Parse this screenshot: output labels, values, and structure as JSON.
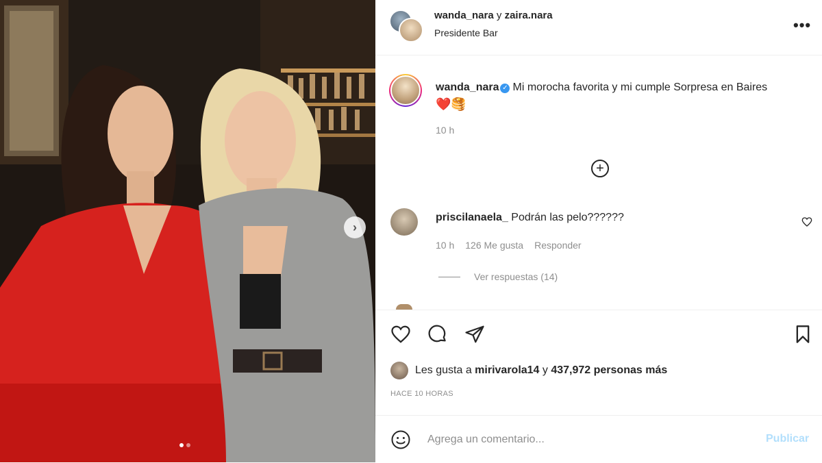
{
  "post": {
    "header": {
      "username_1": "wanda_nara",
      "connector": " y ",
      "username_2": "zaira.nara",
      "location": "Presidente Bar",
      "more_label": "•••"
    },
    "caption": {
      "username": "wanda_nara",
      "text": "Mi morocha favorita y mi cumple Sorpresa en Baires",
      "emojis": "❤️🥞",
      "time": "10 h"
    },
    "comments": [
      {
        "username": "priscilanaela_",
        "text": "Podrán las pelo??????",
        "time": "10 h",
        "likes": "126 Me gusta",
        "reply_label": "Responder",
        "view_replies": "Ver respuestas (14)"
      }
    ],
    "likes": {
      "prefix": "Les gusta a ",
      "user": "mirivarola14",
      "connector": " y ",
      "others": "437,972 personas más"
    },
    "timestamp": "HACE 10 HORAS",
    "add_comment": {
      "placeholder": "Agrega un comentario...",
      "publish_label": "Publicar"
    },
    "carousel": {
      "next_label": "›",
      "slide_count": 2,
      "active_index": 0
    }
  },
  "colors": {
    "accent": "#3897f0",
    "publish_disabled": "#b2dffc",
    "secondary_text": "#8e8e8e"
  }
}
